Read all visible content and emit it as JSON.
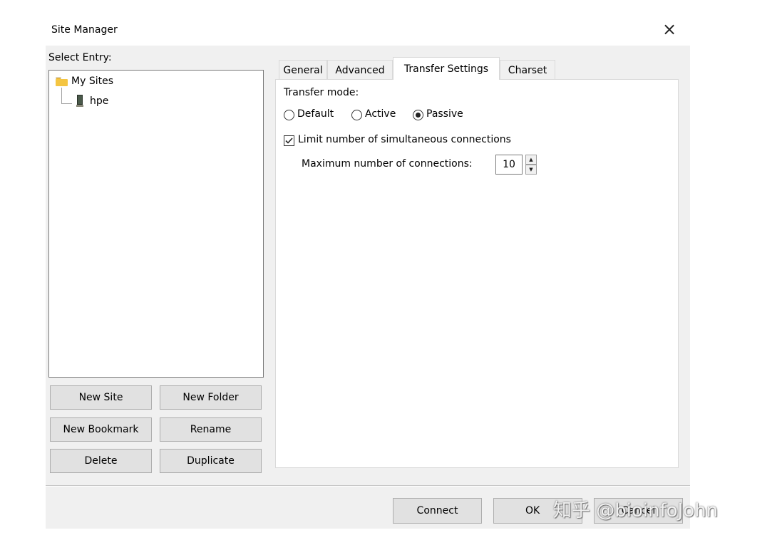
{
  "window": {
    "title": "Site Manager",
    "close_glyph": "×"
  },
  "tree": {
    "label": "Select Entry:",
    "root": {
      "label": "My Sites",
      "icon": "folder-icon"
    },
    "children": [
      {
        "label": "hpe",
        "icon": "server-icon"
      }
    ]
  },
  "buttons": {
    "new_site": "New Site",
    "new_folder": "New Folder",
    "new_bookmark": "New Bookmark",
    "rename": "Rename",
    "delete": "Delete",
    "duplicate": "Duplicate"
  },
  "tabs": [
    {
      "label": "General",
      "active": false
    },
    {
      "label": "Advanced",
      "active": false
    },
    {
      "label": "Transfer Settings",
      "active": true
    },
    {
      "label": "Charset",
      "active": false
    }
  ],
  "transfer": {
    "mode_label": "Transfer mode:",
    "modes": [
      {
        "label": "Default",
        "checked": false
      },
      {
        "label": "Active",
        "checked": false
      },
      {
        "label": "Passive",
        "checked": true
      }
    ],
    "limit_label": "Limit number of simultaneous connections",
    "limit_checked": true,
    "max_label": "Maximum number of connections:",
    "max_value": "10"
  },
  "footer": {
    "connect": "Connect",
    "ok": "OK",
    "cancel": "Cancel"
  },
  "watermark": "知乎 @bioinfoJohn",
  "colors": {
    "dialog_bg": "#f0f0f0",
    "panel_bg": "#ffffff",
    "folder": "#f4c542",
    "button_bg": "#e1e1e1",
    "button_border": "#adadad"
  }
}
